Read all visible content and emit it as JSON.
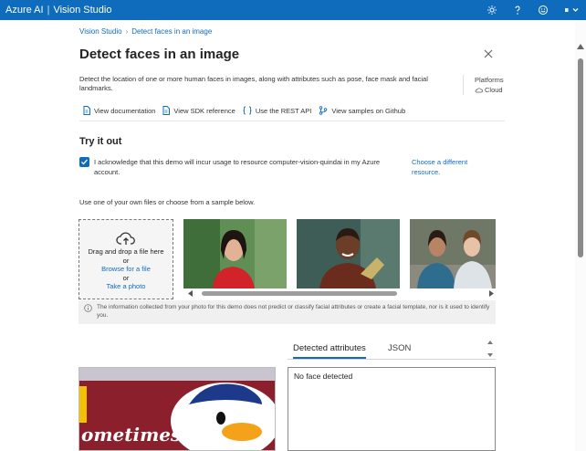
{
  "header": {
    "product": "Azure AI",
    "separator": "|",
    "app_name": "Vision Studio",
    "icons": [
      "gear-icon",
      "help-icon",
      "feedback-smiley-icon",
      "account-menu-icon"
    ]
  },
  "breadcrumb": {
    "root": "Vision Studio",
    "separator": "›",
    "current": "Detect faces in an image"
  },
  "page": {
    "title": "Detect faces in an image",
    "description": "Detect the location of one or more human faces in images, along with attributes such as pose, face mask and facial landmarks.",
    "platforms_label": "Platforms",
    "platforms_value": "Cloud"
  },
  "links": [
    {
      "label": "View documentation",
      "icon": "document-icon"
    },
    {
      "label": "View SDK reference",
      "icon": "document-icon"
    },
    {
      "label": "Use the REST API",
      "icon": "code-braces-icon"
    },
    {
      "label": "View samples on Github",
      "icon": "branch-icon"
    }
  ],
  "try_it": {
    "title": "Try it out",
    "ack_checked": true,
    "ack_text": "I acknowledge that this demo will incur usage to resource computer-vision-quindai in my Azure account.",
    "choose_resource": "Choose a different resource.",
    "use_own": "Use one of your own files or choose from a sample below."
  },
  "upload": {
    "drag_text": "Drag and drop a file here",
    "or1": "or",
    "browse": "Browse for a file",
    "or2": "or",
    "photo": "Take a photo"
  },
  "info_text": "The information collected from your photo for this demo does not predict or classify facial attributes or create a facial template, nor is it used to identify you.",
  "results": {
    "tabs": [
      "Detected attributes",
      "JSON"
    ],
    "active_tab": "Detected attributes",
    "detected_text": "No face detected",
    "preview_text": "ometimes"
  },
  "colors": {
    "accent": "#0f6cbd",
    "header_bg": "#0f6cbd"
  }
}
